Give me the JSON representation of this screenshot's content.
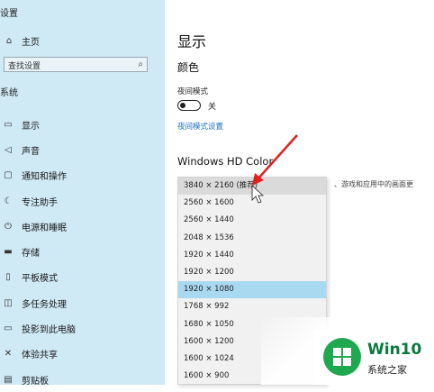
{
  "sidebar": {
    "title": "设置",
    "home_label": "主页",
    "search_placeholder": "查找设置",
    "section": "系统",
    "items": [
      {
        "icon": "monitor-icon",
        "label": "显示"
      },
      {
        "icon": "speaker-icon",
        "label": "声音"
      },
      {
        "icon": "notification-icon",
        "label": "通知和操作"
      },
      {
        "icon": "moon-icon",
        "label": "专注助手"
      },
      {
        "icon": "power-icon",
        "label": "电源和睡眠"
      },
      {
        "icon": "storage-icon",
        "label": "存储"
      },
      {
        "icon": "tablet-icon",
        "label": "平板模式"
      },
      {
        "icon": "multitask-icon",
        "label": "多任务处理"
      },
      {
        "icon": "project-icon",
        "label": "投影到此电脑"
      },
      {
        "icon": "share-icon",
        "label": "体验共享"
      },
      {
        "icon": "clipboard-icon",
        "label": "剪贴板"
      }
    ]
  },
  "main": {
    "title": "显示",
    "color_section": "颜色",
    "night_light_label": "夜间模式",
    "night_light_state": "关",
    "night_light_link": "夜间模式设置",
    "hd_color_title": "Windows HD Color",
    "hd_color_desc": "、游戏和应用中的画面更"
  },
  "resolution_dropdown": {
    "options": [
      "3840 × 2160 (推荐)",
      "2560 × 1600",
      "2560 × 1440",
      "2048 × 1536",
      "1920 × 1440",
      "1920 × 1200",
      "1920 × 1080",
      "1768 × 992",
      "1680 × 1050",
      "1600 × 1200",
      "1600 × 1024",
      "1600 × 900"
    ],
    "hovered_index": 0,
    "selected_index": 6
  },
  "watermark": {
    "brand": "Win10",
    "subtitle": "系统之家"
  },
  "colors": {
    "sidebar_bg": "#cfe9f5",
    "selected_option": "#a9d8f1",
    "link": "#1a6fc4",
    "arrow": "#e02020"
  }
}
